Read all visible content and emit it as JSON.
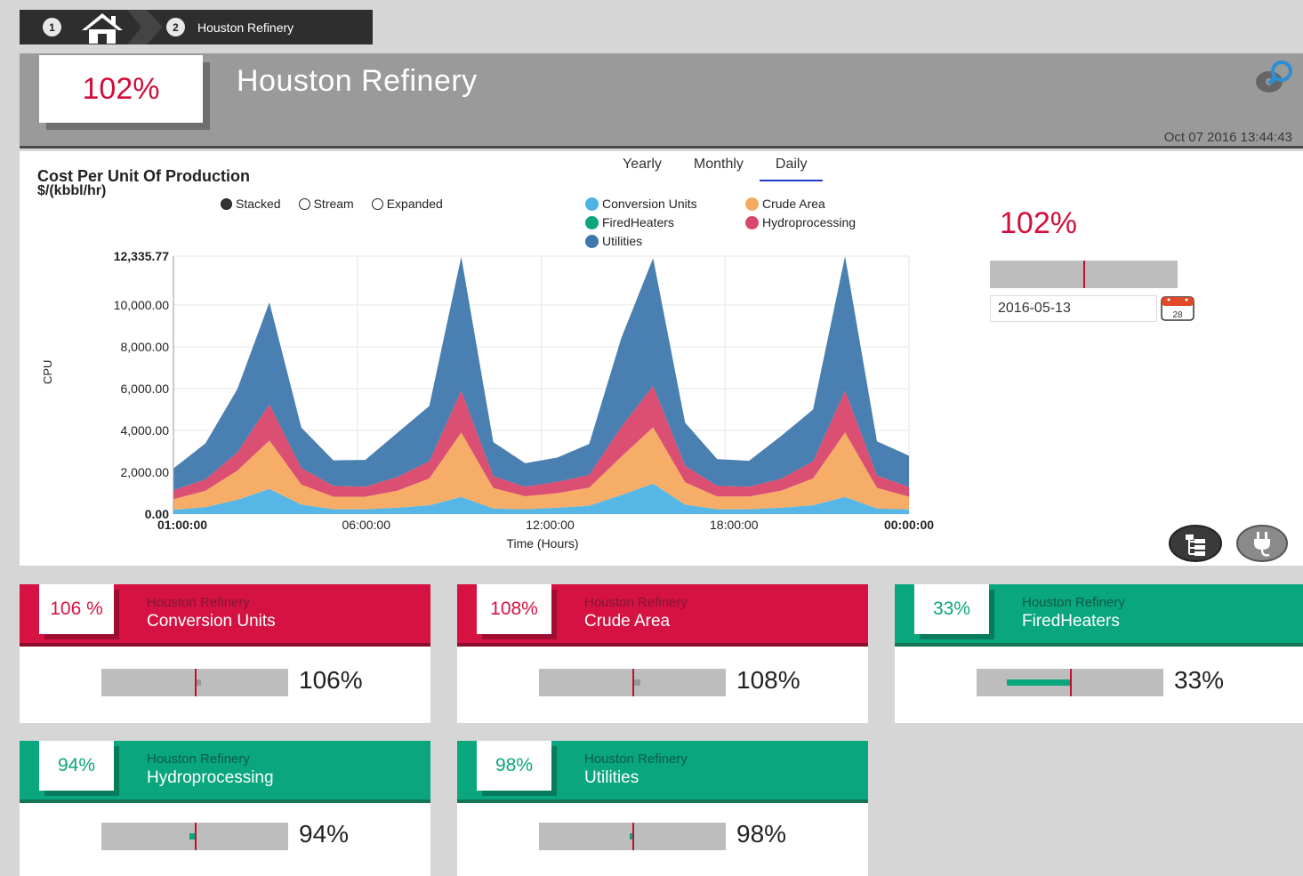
{
  "breadcrumb": {
    "step1": "1",
    "step2": "2",
    "label": "Houston Refinery"
  },
  "header": {
    "kpi": "102%",
    "title": "Houston Refinery",
    "timestamp": "Oct 07 2016 13:44:43"
  },
  "chart_panel": {
    "tabs": [
      "Yearly",
      "Monthly",
      "Daily"
    ],
    "active_tab": "Daily",
    "title": "Cost Per Unit Of Production",
    "unit": "$/(kbbl/hr)",
    "modes": [
      "Stacked",
      "Stream",
      "Expanded"
    ],
    "selected_mode": "Stacked",
    "right_kpi": "102%",
    "right_kpi_level": 1.02,
    "date_value": "2016-05-13",
    "calendar_day": "28"
  },
  "chart_data": {
    "type": "area",
    "stacked": true,
    "xlabel": "Time (Hours)",
    "ylabel": "CPU",
    "ylim": [
      0,
      12335.77
    ],
    "yticks": [
      "0.00",
      "2,000.00",
      "4,000.00",
      "6,000.00",
      "8,000.00",
      "10,000.00",
      "12,335.77"
    ],
    "ytick_values": [
      0,
      2000,
      4000,
      6000,
      8000,
      10000,
      12335.77
    ],
    "xticks": [
      "01:00:00",
      "06:00:00",
      "12:00:00",
      "18:00:00",
      "00:00:00"
    ],
    "x": [
      "01:00",
      "02:00",
      "03:00",
      "04:00",
      "05:00",
      "06:00",
      "07:00",
      "08:00",
      "09:00",
      "10:00",
      "11:00",
      "12:00",
      "13:00",
      "14:00",
      "15:00",
      "16:00",
      "17:00",
      "18:00",
      "19:00",
      "20:00",
      "21:00",
      "22:00",
      "23:00",
      "00:00"
    ],
    "grid": true,
    "legend_placement": "top",
    "series": [
      {
        "name": "Conversion Units",
        "color": "#4db3e6",
        "values": [
          200,
          330,
          680,
          1200,
          450,
          230,
          230,
          300,
          420,
          820,
          270,
          230,
          300,
          400,
          900,
          1450,
          450,
          230,
          230,
          300,
          420,
          820,
          270,
          220
        ]
      },
      {
        "name": "Crude Area",
        "color": "#f5a95f",
        "values": [
          510,
          780,
          1400,
          2320,
          960,
          600,
          600,
          820,
          1280,
          3080,
          970,
          620,
          700,
          860,
          1840,
          2700,
          1070,
          610,
          610,
          820,
          1280,
          3080,
          980,
          610
        ]
      },
      {
        "name": "FiredHeaters",
        "color": "#0aa67d",
        "values": [
          0,
          0,
          0,
          0,
          0,
          0,
          0,
          0,
          0,
          0,
          0,
          0,
          0,
          0,
          0,
          0,
          0,
          0,
          0,
          0,
          0,
          0,
          0,
          0
        ]
      },
      {
        "name": "Hydroprocessing",
        "color": "#d9466b",
        "values": [
          430,
          550,
          870,
          1730,
          790,
          520,
          480,
          660,
          830,
          2000,
          570,
          460,
          540,
          610,
          1430,
          1980,
          790,
          510,
          470,
          570,
          820,
          2000,
          590,
          470
        ]
      },
      {
        "name": "Utilities",
        "color": "#3f78ad",
        "values": [
          1040,
          1720,
          3030,
          4880,
          1940,
          1220,
          1280,
          2100,
          2640,
          6400,
          1630,
          1120,
          1160,
          1480,
          4230,
          6110,
          2060,
          1280,
          1240,
          2040,
          2480,
          6430,
          1640,
          1490
        ]
      }
    ]
  },
  "cards": [
    {
      "pct": "106 %",
      "sub": "Houston Refinery",
      "name": "Conversion Units",
      "value": "106%",
      "status": "red",
      "level": 1.06
    },
    {
      "pct": "108%",
      "sub": "Houston Refinery",
      "name": "Crude Area",
      "value": "108%",
      "status": "red",
      "level": 1.08
    },
    {
      "pct": "33%",
      "sub": "Houston Refinery",
      "name": "FiredHeaters",
      "value": "33%",
      "status": "green",
      "level": 0.33
    },
    {
      "pct": "94%",
      "sub": "Houston Refinery",
      "name": "Hydroprocessing",
      "value": "94%",
      "status": "green",
      "level": 0.94
    },
    {
      "pct": "98%",
      "sub": "Houston Refinery",
      "name": "Utilities",
      "value": "98%",
      "status": "green",
      "level": 0.98
    }
  ],
  "colors": {
    "alert": "#d51242",
    "ok": "#0aa67d",
    "active_tab": "#1f3dcc"
  }
}
